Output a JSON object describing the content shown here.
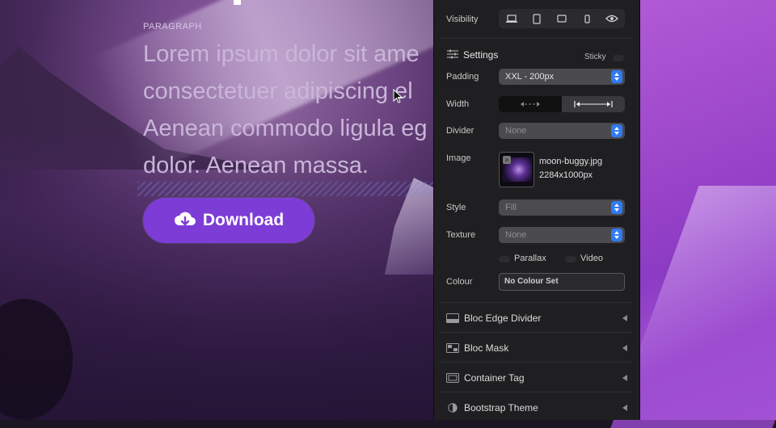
{
  "canvas": {
    "section_label": "PARAGRAPH",
    "paragraph_lines": [
      "Lorem ipsum dolor sit ame",
      "consectetuer adipiscing el",
      "Aenean commodo ligula eg",
      "dolor. Aenean massa."
    ],
    "download_label": "Download",
    "download_color": "#7d3cd6"
  },
  "inspector": {
    "visibility_label": "Visibility",
    "visibility_icons": [
      "laptop-icon",
      "tablet-icon",
      "tablet-landscape-icon",
      "phone-icon",
      "eye-icon"
    ],
    "settings_title": "Settings",
    "sticky_label": "Sticky",
    "padding_label": "Padding",
    "padding_value": "XXL - 200px",
    "width_label": "Width",
    "divider_label": "Divider",
    "divider_value": "None",
    "image_label": "Image",
    "image_filename": "moon-buggy.jpg",
    "image_size": "2284x1000px",
    "style_label": "Style",
    "style_value": "Fill",
    "texture_label": "Texture",
    "texture_value": "None",
    "parallax_label": "Parallax",
    "video_label": "Video",
    "colour_label": "Colour",
    "colour_value": "No Colour Set",
    "sections": [
      {
        "label": "Bloc Edge Divider",
        "icon": "edge-divider-icon"
      },
      {
        "label": "Bloc Mask",
        "icon": "mask-icon"
      },
      {
        "label": "Container Tag",
        "icon": "container-icon"
      },
      {
        "label": "Bootstrap Theme",
        "icon": "theme-icon"
      }
    ],
    "accent_color": "#2f7bf6"
  }
}
